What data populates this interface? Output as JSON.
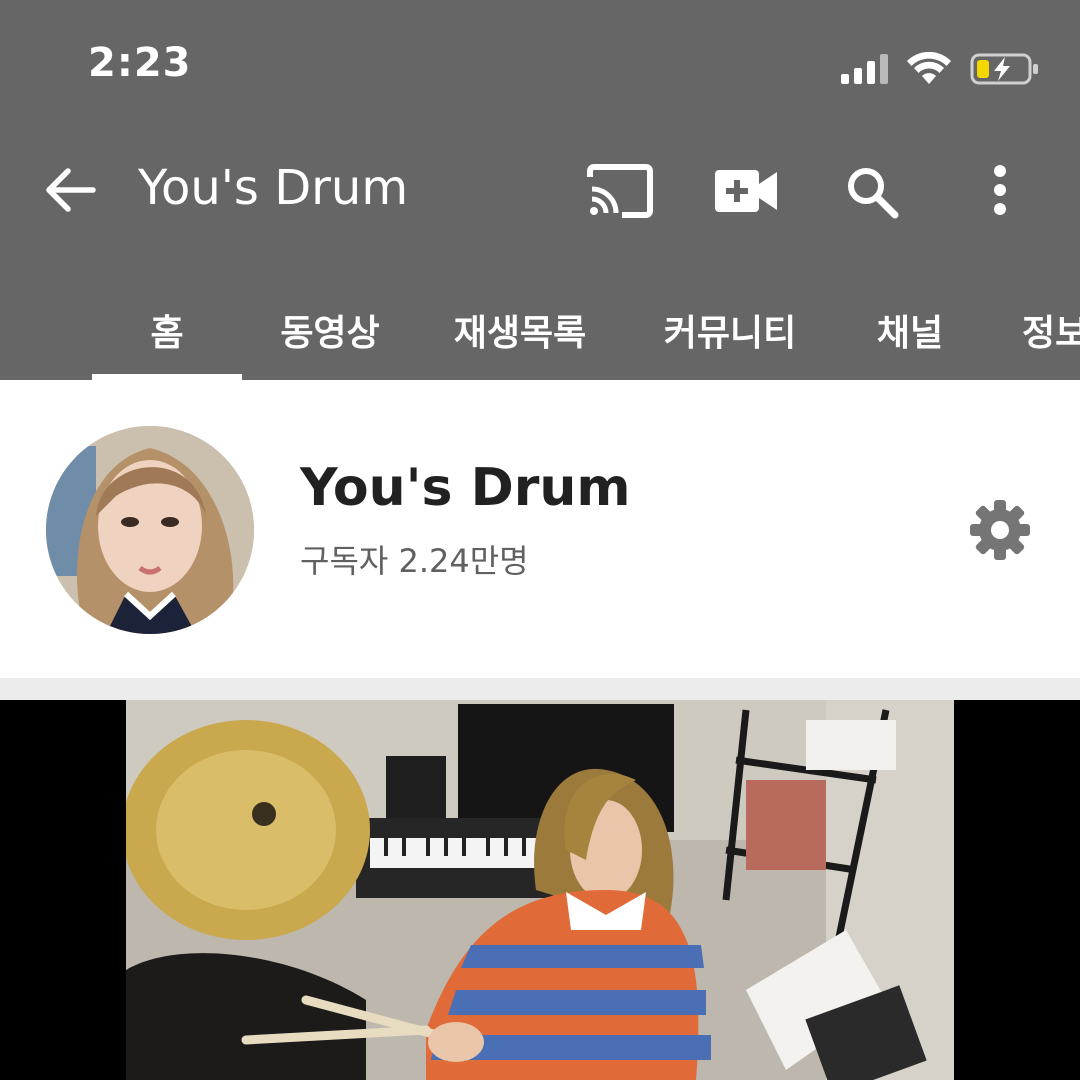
{
  "status_bar": {
    "time": "2:23",
    "icons": [
      "signal-icon",
      "wifi-icon",
      "battery-charging-icon"
    ]
  },
  "app_bar": {
    "title": "You's Drum",
    "back_icon": "back-arrow-icon",
    "actions": [
      "cast-icon",
      "create-video-icon",
      "search-icon",
      "more-options-icon"
    ]
  },
  "tabs": [
    {
      "label": "홈",
      "selected": true
    },
    {
      "label": "동영상",
      "selected": false
    },
    {
      "label": "재생목록",
      "selected": false
    },
    {
      "label": "커뮤니티",
      "selected": false
    },
    {
      "label": "채널",
      "selected": false
    },
    {
      "label": "정보",
      "selected": false
    }
  ],
  "channel": {
    "name": "You's Drum",
    "subscribers": "구독자 2.24만명",
    "settings_icon": "gear-icon"
  },
  "colors": {
    "app_bar_bg": "#666666",
    "battery_fill": "#f4d600",
    "text_primary": "#212121",
    "text_secondary": "#606060",
    "settings_icon": "#757575"
  }
}
